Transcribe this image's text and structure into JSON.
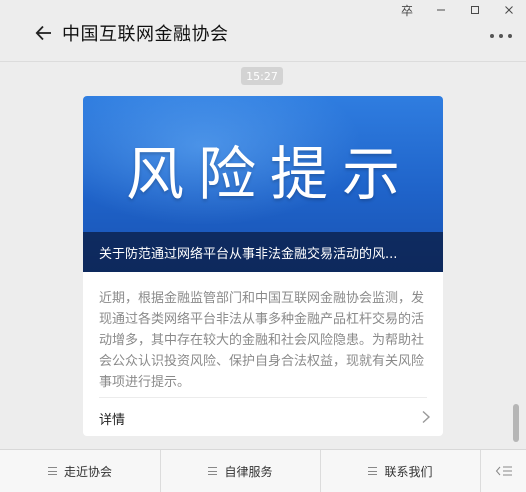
{
  "window": {
    "pin_label": "卒",
    "minimize_label": "minimize",
    "maximize_label": "maximize",
    "close_label": "close"
  },
  "header": {
    "title": "中国互联网金融协会",
    "back_icon": "arrow-left-icon",
    "more_icon": "more-dots-icon"
  },
  "message": {
    "timestamp": "15:27",
    "article": {
      "cover_text": "风险提示",
      "cover_colors": {
        "top": "#2f7de0",
        "bottom": "#1852b3"
      },
      "title": "关于防范通过网络平台从事非法金融交易活动的风...",
      "summary": "近期，根据金融监管部门和中国互联网金融协会监测，发现通过各类网络平台非法从事多种金融产品杠杆交易的活动增多，其中存在较大的金融和社会风险隐患。为帮助社会公众认识投资风险、保护自身合法权益，现就有关风险事项进行提示。",
      "detail_label": "详情",
      "detail_icon": "chevron-right-icon"
    }
  },
  "menu": {
    "items": [
      {
        "label": "走近协会",
        "icon": "menu-lines-icon"
      },
      {
        "label": "自律服务",
        "icon": "menu-lines-icon"
      },
      {
        "label": "联系我们",
        "icon": "menu-lines-icon"
      }
    ],
    "keyboard_icon": "keyboard-toggle-icon"
  },
  "colors": {
    "background": "#ededed",
    "card": "#ffffff",
    "summary_text": "#8a8a8a"
  }
}
